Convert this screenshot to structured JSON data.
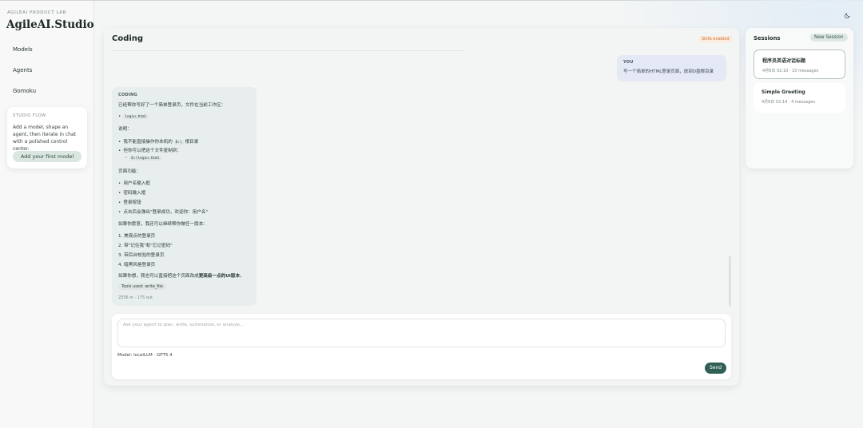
{
  "brand": {
    "kicker": "AGILEAI PRODUCT LAB",
    "title": "AgileAI.Studio"
  },
  "nav": [
    {
      "label": "Models"
    },
    {
      "label": "Agents"
    },
    {
      "label": "Gomoku"
    }
  ],
  "studio_flow": {
    "kicker": "STUDIO FLOW",
    "text": "Add a model, shape an agent, then iterate in chat with a polished control center.",
    "button": "Add your first model"
  },
  "icons": {
    "theme_toggle": "moon-icon"
  },
  "chat": {
    "title": "Coding",
    "badge": "Skills enabled",
    "user_message": {
      "who": "YOU",
      "text": "写一个简单的HTML登录页面，放到D盘根目录"
    },
    "ai_message": {
      "who": "CODING",
      "intro": "已经帮你写好了一个简单登录页，文件在当前工作区：",
      "file": "login.html",
      "notes_title": "说明：",
      "note1_prefix": "我不能直接操作你本机的",
      "note1_code": "D:\\",
      "note1_suffix": "根目录",
      "note2": "但你可以把这个文件复制到：",
      "copy_target": "D:\\login.html",
      "features_title": "页面功能：",
      "features": [
        "用户名输入框",
        "密码输入框",
        "登录按钮",
        "点击后会弹出\"登录成功，欢迎你：用户名\""
      ],
      "versions_intro": "如果你愿意，我还可以继续帮你做任一版本：",
      "versions": [
        "1. 美观点的登录页",
        "2. 带\"记住我\"和\"忘记密码\"",
        "3. 带后台校验的登录页",
        "4. 暗黑风格登录页"
      ],
      "closing_prefix": "如果你想，我也可以直接把这个页面改成",
      "closing_bold": "更高级一点的UI版本",
      "closing_suffix": "。",
      "tools_used": "Tools used: write_file",
      "tokens": "2556 in · 175 out"
    },
    "composer": {
      "placeholder": "Ask your agent to plan, write, summarize, or analyze...",
      "model_label": "Model: localLLM · GPT5.4",
      "send_label": "Send"
    }
  },
  "sessions": {
    "title": "Sessions",
    "new_button": "New Session",
    "items": [
      {
        "title": "程序员英语对话标题",
        "meta": "4月6日 02:10 · 10 messages",
        "selected": true
      },
      {
        "title": "Simple Greeting",
        "meta": "4月6日 02:14 · 4 messages",
        "selected": false
      }
    ]
  }
}
